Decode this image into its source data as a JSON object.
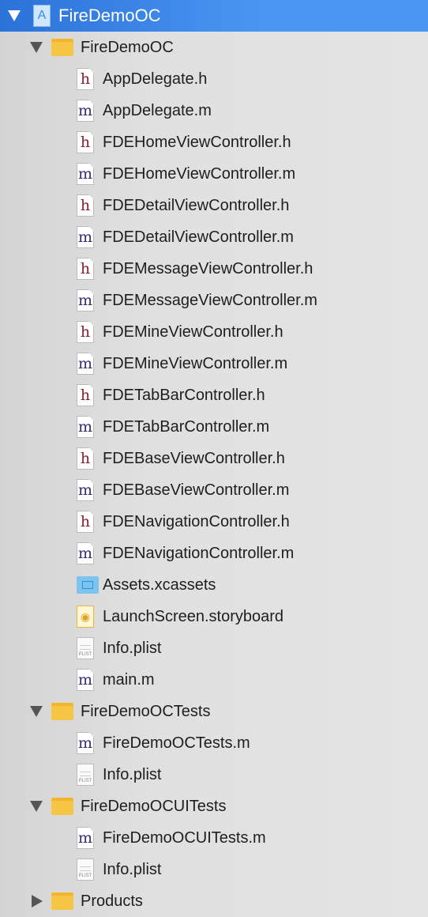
{
  "navigator": {
    "items": [
      {
        "label": "FireDemoOC",
        "type": "project",
        "level": 0,
        "disclosure": "open",
        "selected": true
      },
      {
        "label": "FireDemoOC",
        "type": "folder",
        "level": 1,
        "disclosure": "open"
      },
      {
        "label": "AppDelegate.h",
        "type": "h",
        "level": 2
      },
      {
        "label": "AppDelegate.m",
        "type": "m",
        "level": 2
      },
      {
        "label": "FDEHomeViewController.h",
        "type": "h",
        "level": 2
      },
      {
        "label": "FDEHomeViewController.m",
        "type": "m",
        "level": 2
      },
      {
        "label": "FDEDetailViewController.h",
        "type": "h",
        "level": 2
      },
      {
        "label": "FDEDetailViewController.m",
        "type": "m",
        "level": 2
      },
      {
        "label": "FDEMessageViewController.h",
        "type": "h",
        "level": 2
      },
      {
        "label": "FDEMessageViewController.m",
        "type": "m",
        "level": 2
      },
      {
        "label": "FDEMineViewController.h",
        "type": "h",
        "level": 2
      },
      {
        "label": "FDEMineViewController.m",
        "type": "m",
        "level": 2
      },
      {
        "label": "FDETabBarController.h",
        "type": "h",
        "level": 2
      },
      {
        "label": "FDETabBarController.m",
        "type": "m",
        "level": 2
      },
      {
        "label": "FDEBaseViewController.h",
        "type": "h",
        "level": 2
      },
      {
        "label": "FDEBaseViewController.m",
        "type": "m",
        "level": 2
      },
      {
        "label": "FDENavigationController.h",
        "type": "h",
        "level": 2
      },
      {
        "label": "FDENavigationController.m",
        "type": "m",
        "level": 2
      },
      {
        "label": "Assets.xcassets",
        "type": "assets",
        "level": 2
      },
      {
        "label": "LaunchScreen.storyboard",
        "type": "storyboard",
        "level": 2
      },
      {
        "label": "Info.plist",
        "type": "plist",
        "level": 2
      },
      {
        "label": "main.m",
        "type": "m",
        "level": 2
      },
      {
        "label": "FireDemoOCTests",
        "type": "folder",
        "level": 1,
        "disclosure": "open"
      },
      {
        "label": "FireDemoOCTests.m",
        "type": "m",
        "level": 2
      },
      {
        "label": "Info.plist",
        "type": "plist",
        "level": 2
      },
      {
        "label": "FireDemoOCUITests",
        "type": "folder",
        "level": 1,
        "disclosure": "open"
      },
      {
        "label": "FireDemoOCUITests.m",
        "type": "m",
        "level": 2
      },
      {
        "label": "Info.plist",
        "type": "plist",
        "level": 2
      },
      {
        "label": "Products",
        "type": "folder",
        "level": 1,
        "disclosure": "closed"
      }
    ]
  },
  "colors": {
    "selection": "#4a94f0",
    "header_icon": "#8a1e2e",
    "impl_icon": "#3a2a7a",
    "folder": "#f6c544"
  }
}
